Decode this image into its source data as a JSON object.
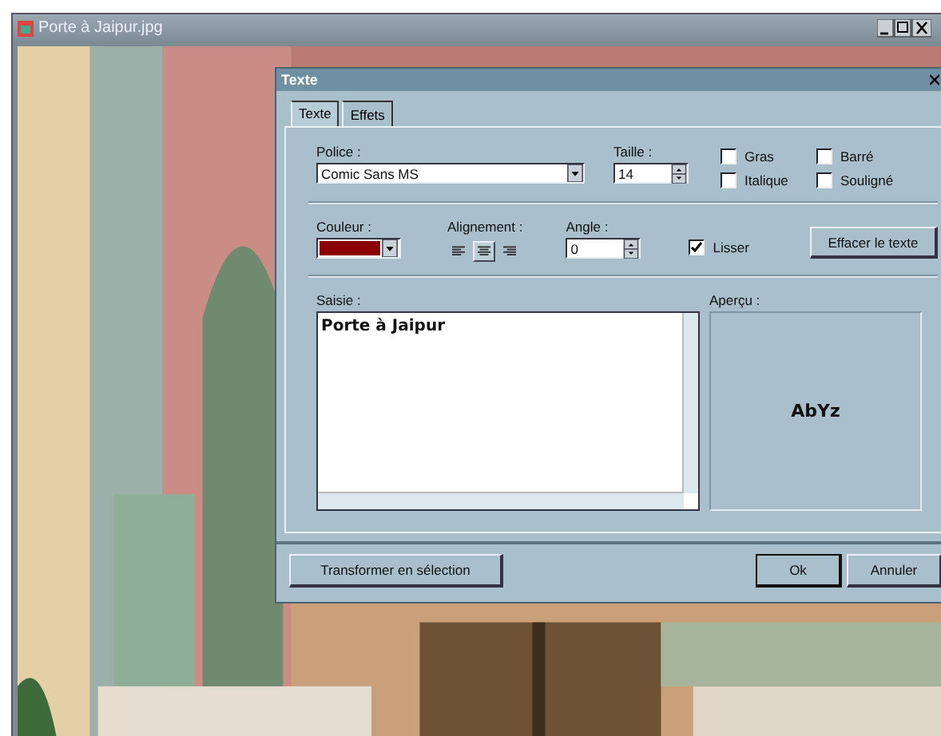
{
  "window": {
    "title": "Porte à Jaipur.jpg"
  },
  "dialog": {
    "title": "Texte",
    "tabs": [
      {
        "label": "Texte",
        "selected": true
      },
      {
        "label": "Effets",
        "selected": false
      }
    ],
    "font": {
      "label": "Police :",
      "value": "Comic Sans MS"
    },
    "size": {
      "label": "Taille :",
      "value": "14"
    },
    "styles": [
      {
        "label": "Gras",
        "checked": false
      },
      {
        "label": "Barré",
        "checked": false
      },
      {
        "label": "Italique",
        "checked": false
      },
      {
        "label": "Souligné",
        "checked": false
      }
    ],
    "color": {
      "label": "Couleur :",
      "color": "#8b0000"
    },
    "alignment": {
      "label": "Alignement :",
      "options": [
        {
          "kind": "left",
          "selected": false
        },
        {
          "kind": "center",
          "selected": true
        },
        {
          "kind": "right",
          "selected": false
        }
      ]
    },
    "angle": {
      "label": "Angle :",
      "value": "0"
    },
    "smooth": {
      "label": "Lisser",
      "checked": true
    },
    "clear_button": "Effacer le texte",
    "input": {
      "label": "Saisie :",
      "value": "Porte à Jaipur"
    },
    "preview": {
      "label": "Aperçu :",
      "sample": "AbYz"
    },
    "buttons": [
      {
        "label": "Transformer en sélection",
        "default": false
      },
      {
        "label": "Ok",
        "default": true
      },
      {
        "label": "Annuler",
        "default": false
      }
    ]
  }
}
